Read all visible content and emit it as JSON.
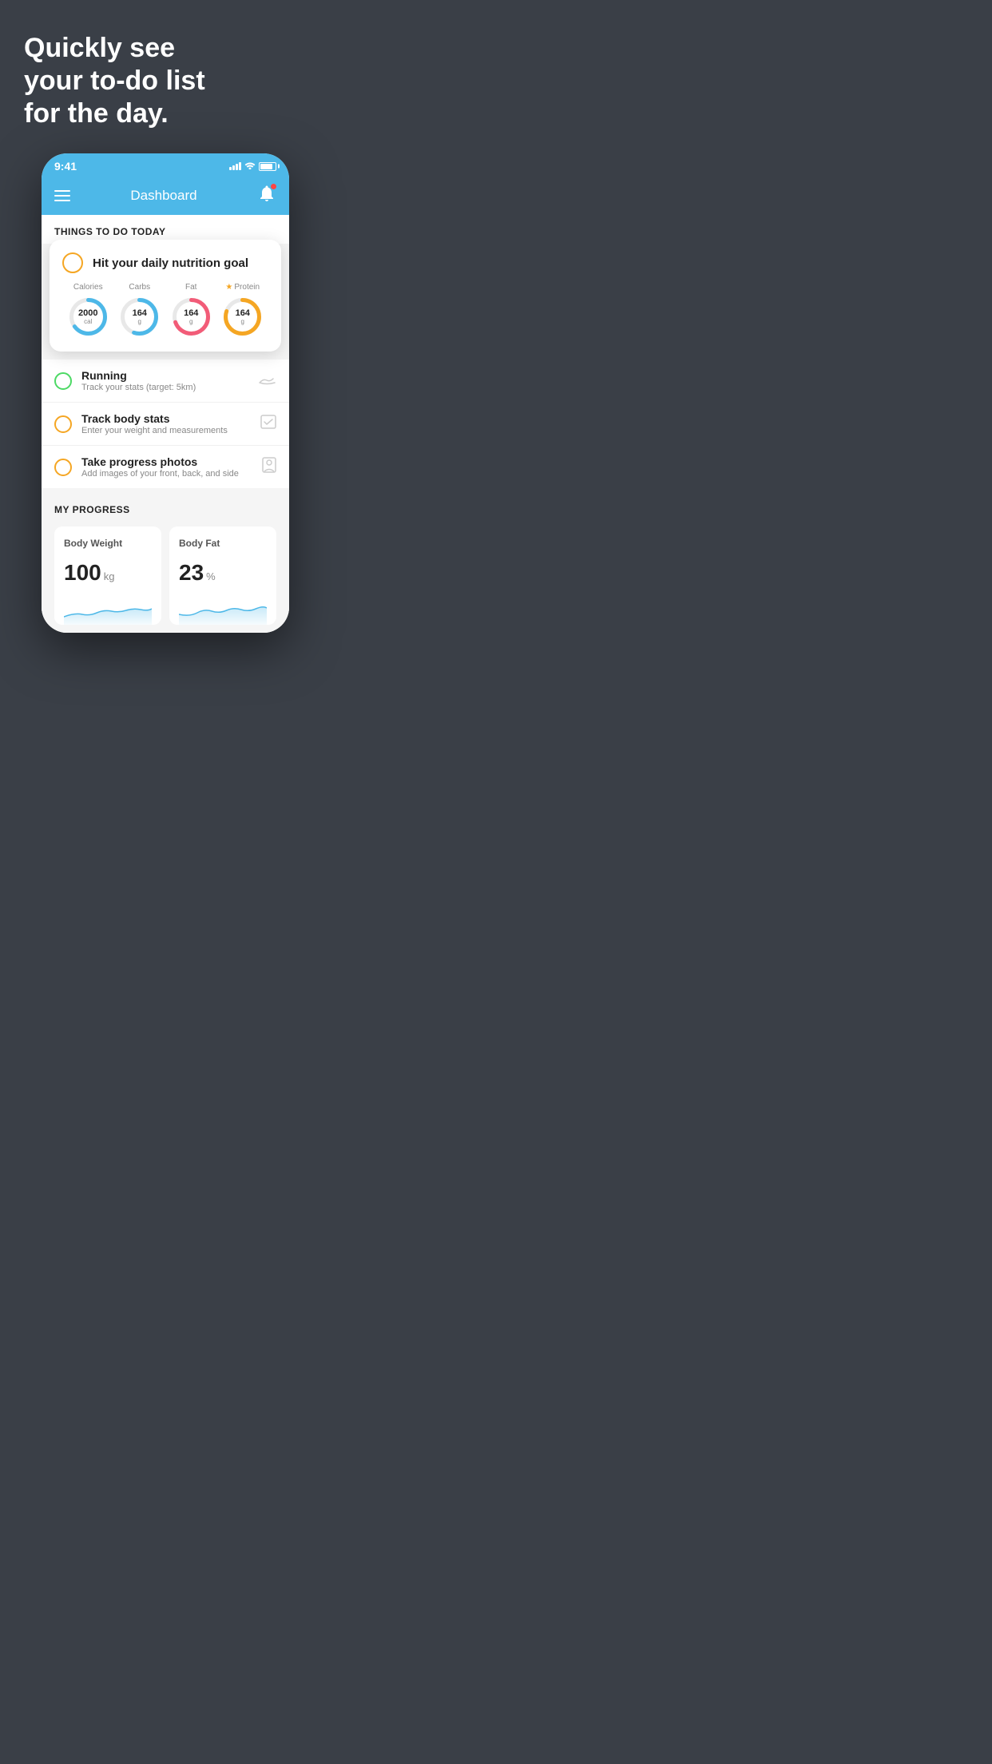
{
  "background": {
    "color": "#3a3f47"
  },
  "headline": {
    "line1": "Quickly see",
    "line2": "your to-do list",
    "line3": "for the day."
  },
  "statusBar": {
    "time": "9:41",
    "color": "#4db8e8"
  },
  "navbar": {
    "title": "Dashboard",
    "color": "#4db8e8"
  },
  "thingsToDo": {
    "sectionTitle": "THINGS TO DO TODAY"
  },
  "floatingCard": {
    "title": "Hit your daily nutrition goal",
    "nutrition": [
      {
        "label": "Calories",
        "value": "2000",
        "unit": "cal",
        "color": "#4db8e8",
        "percent": 65
      },
      {
        "label": "Carbs",
        "value": "164",
        "unit": "g",
        "color": "#4db8e8",
        "percent": 55
      },
      {
        "label": "Fat",
        "value": "164",
        "unit": "g",
        "color": "#f25c78",
        "percent": 70
      },
      {
        "label": "Protein",
        "value": "164",
        "unit": "g",
        "color": "#f5a623",
        "percent": 80,
        "starred": true
      }
    ]
  },
  "listItems": [
    {
      "title": "Running",
      "subtitle": "Track your stats (target: 5km)",
      "checkColor": "green",
      "icon": "shoe"
    },
    {
      "title": "Track body stats",
      "subtitle": "Enter your weight and measurements",
      "checkColor": "yellow",
      "icon": "scale"
    },
    {
      "title": "Take progress photos",
      "subtitle": "Add images of your front, back, and side",
      "checkColor": "yellow",
      "icon": "person"
    }
  ],
  "progress": {
    "sectionTitle": "MY PROGRESS",
    "cards": [
      {
        "title": "Body Weight",
        "value": "100",
        "unit": "kg"
      },
      {
        "title": "Body Fat",
        "value": "23",
        "unit": "%"
      }
    ]
  }
}
